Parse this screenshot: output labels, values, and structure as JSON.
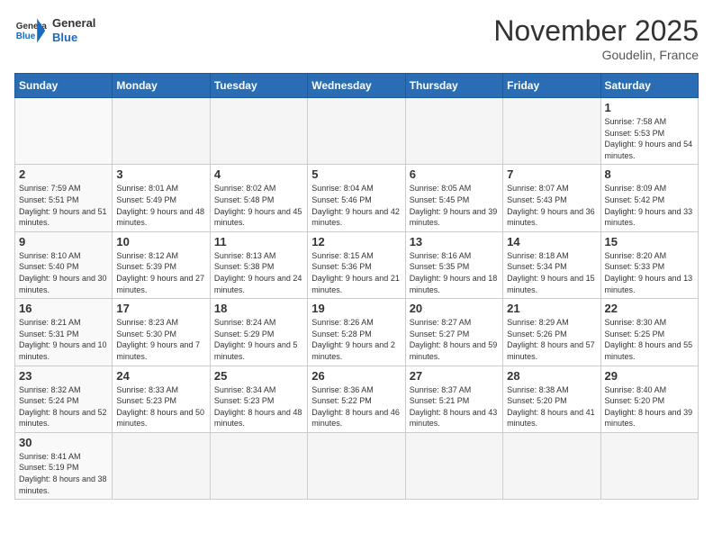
{
  "logo": {
    "general": "General",
    "blue": "Blue"
  },
  "header": {
    "month": "November 2025",
    "location": "Goudelin, France"
  },
  "weekdays": [
    "Sunday",
    "Monday",
    "Tuesday",
    "Wednesday",
    "Thursday",
    "Friday",
    "Saturday"
  ],
  "weeks": [
    [
      {
        "day": "",
        "info": ""
      },
      {
        "day": "",
        "info": ""
      },
      {
        "day": "",
        "info": ""
      },
      {
        "day": "",
        "info": ""
      },
      {
        "day": "",
        "info": ""
      },
      {
        "day": "",
        "info": ""
      },
      {
        "day": "1",
        "info": "Sunrise: 7:58 AM\nSunset: 5:53 PM\nDaylight: 9 hours and 54 minutes."
      }
    ],
    [
      {
        "day": "2",
        "info": "Sunrise: 7:59 AM\nSunset: 5:51 PM\nDaylight: 9 hours and 51 minutes."
      },
      {
        "day": "3",
        "info": "Sunrise: 8:01 AM\nSunset: 5:49 PM\nDaylight: 9 hours and 48 minutes."
      },
      {
        "day": "4",
        "info": "Sunrise: 8:02 AM\nSunset: 5:48 PM\nDaylight: 9 hours and 45 minutes."
      },
      {
        "day": "5",
        "info": "Sunrise: 8:04 AM\nSunset: 5:46 PM\nDaylight: 9 hours and 42 minutes."
      },
      {
        "day": "6",
        "info": "Sunrise: 8:05 AM\nSunset: 5:45 PM\nDaylight: 9 hours and 39 minutes."
      },
      {
        "day": "7",
        "info": "Sunrise: 8:07 AM\nSunset: 5:43 PM\nDaylight: 9 hours and 36 minutes."
      },
      {
        "day": "8",
        "info": "Sunrise: 8:09 AM\nSunset: 5:42 PM\nDaylight: 9 hours and 33 minutes."
      }
    ],
    [
      {
        "day": "9",
        "info": "Sunrise: 8:10 AM\nSunset: 5:40 PM\nDaylight: 9 hours and 30 minutes."
      },
      {
        "day": "10",
        "info": "Sunrise: 8:12 AM\nSunset: 5:39 PM\nDaylight: 9 hours and 27 minutes."
      },
      {
        "day": "11",
        "info": "Sunrise: 8:13 AM\nSunset: 5:38 PM\nDaylight: 9 hours and 24 minutes."
      },
      {
        "day": "12",
        "info": "Sunrise: 8:15 AM\nSunset: 5:36 PM\nDaylight: 9 hours and 21 minutes."
      },
      {
        "day": "13",
        "info": "Sunrise: 8:16 AM\nSunset: 5:35 PM\nDaylight: 9 hours and 18 minutes."
      },
      {
        "day": "14",
        "info": "Sunrise: 8:18 AM\nSunset: 5:34 PM\nDaylight: 9 hours and 15 minutes."
      },
      {
        "day": "15",
        "info": "Sunrise: 8:20 AM\nSunset: 5:33 PM\nDaylight: 9 hours and 13 minutes."
      }
    ],
    [
      {
        "day": "16",
        "info": "Sunrise: 8:21 AM\nSunset: 5:31 PM\nDaylight: 9 hours and 10 minutes."
      },
      {
        "day": "17",
        "info": "Sunrise: 8:23 AM\nSunset: 5:30 PM\nDaylight: 9 hours and 7 minutes."
      },
      {
        "day": "18",
        "info": "Sunrise: 8:24 AM\nSunset: 5:29 PM\nDaylight: 9 hours and 5 minutes."
      },
      {
        "day": "19",
        "info": "Sunrise: 8:26 AM\nSunset: 5:28 PM\nDaylight: 9 hours and 2 minutes."
      },
      {
        "day": "20",
        "info": "Sunrise: 8:27 AM\nSunset: 5:27 PM\nDaylight: 8 hours and 59 minutes."
      },
      {
        "day": "21",
        "info": "Sunrise: 8:29 AM\nSunset: 5:26 PM\nDaylight: 8 hours and 57 minutes."
      },
      {
        "day": "22",
        "info": "Sunrise: 8:30 AM\nSunset: 5:25 PM\nDaylight: 8 hours and 55 minutes."
      }
    ],
    [
      {
        "day": "23",
        "info": "Sunrise: 8:32 AM\nSunset: 5:24 PM\nDaylight: 8 hours and 52 minutes."
      },
      {
        "day": "24",
        "info": "Sunrise: 8:33 AM\nSunset: 5:23 PM\nDaylight: 8 hours and 50 minutes."
      },
      {
        "day": "25",
        "info": "Sunrise: 8:34 AM\nSunset: 5:23 PM\nDaylight: 8 hours and 48 minutes."
      },
      {
        "day": "26",
        "info": "Sunrise: 8:36 AM\nSunset: 5:22 PM\nDaylight: 8 hours and 46 minutes."
      },
      {
        "day": "27",
        "info": "Sunrise: 8:37 AM\nSunset: 5:21 PM\nDaylight: 8 hours and 43 minutes."
      },
      {
        "day": "28",
        "info": "Sunrise: 8:38 AM\nSunset: 5:20 PM\nDaylight: 8 hours and 41 minutes."
      },
      {
        "day": "29",
        "info": "Sunrise: 8:40 AM\nSunset: 5:20 PM\nDaylight: 8 hours and 39 minutes."
      }
    ],
    [
      {
        "day": "30",
        "info": "Sunrise: 8:41 AM\nSunset: 5:19 PM\nDaylight: 8 hours and 38 minutes."
      },
      {
        "day": "",
        "info": ""
      },
      {
        "day": "",
        "info": ""
      },
      {
        "day": "",
        "info": ""
      },
      {
        "day": "",
        "info": ""
      },
      {
        "day": "",
        "info": ""
      },
      {
        "day": "",
        "info": ""
      }
    ]
  ]
}
